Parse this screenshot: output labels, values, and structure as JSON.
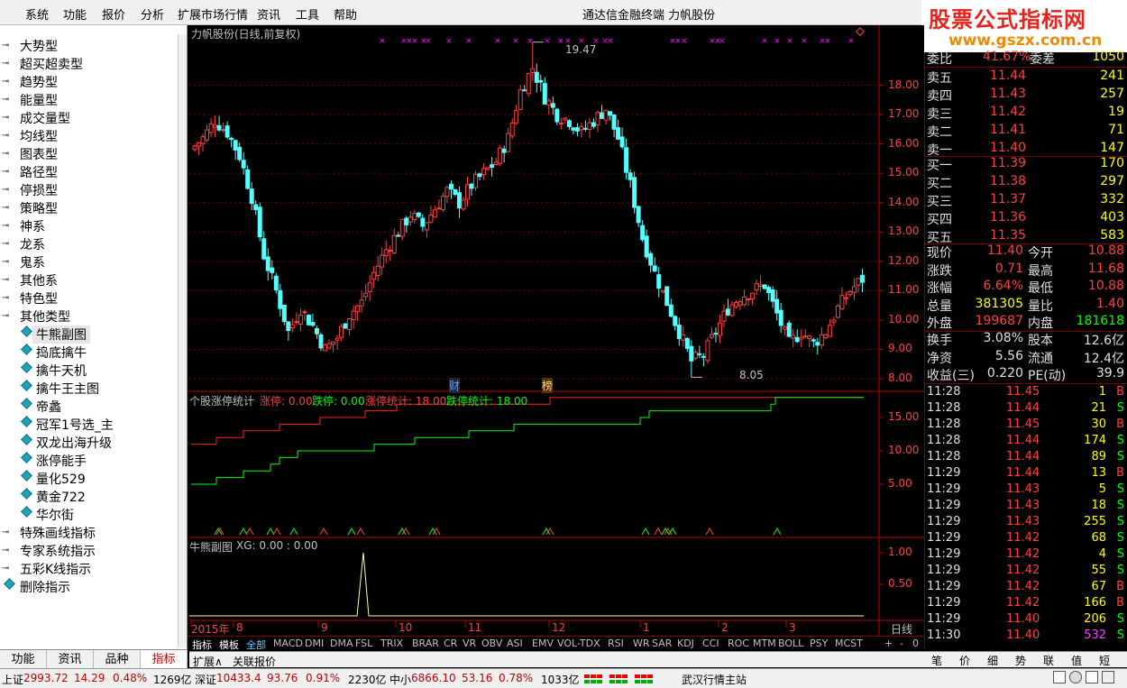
{
  "menu": [
    "系统",
    "功能",
    "报价",
    "分析",
    "扩展市场行情",
    "资讯",
    "工具",
    "帮助"
  ],
  "app_title": "通达信金融终端   力帆股份",
  "watermark": {
    "title": "股票公式指标网",
    "url": "www.gszx.com.cn"
  },
  "tree": [
    {
      "label": "大势型",
      "level": 0
    },
    {
      "label": "超买超卖型",
      "level": 0
    },
    {
      "label": "趋势型",
      "level": 0
    },
    {
      "label": "能量型",
      "level": 0
    },
    {
      "label": "成交量型",
      "level": 0
    },
    {
      "label": "均线型",
      "level": 0
    },
    {
      "label": "图表型",
      "level": 0
    },
    {
      "label": "路径型",
      "level": 0
    },
    {
      "label": "停损型",
      "level": 0
    },
    {
      "label": "策略型",
      "level": 0
    },
    {
      "label": "神系",
      "level": 0
    },
    {
      "label": "龙系",
      "level": 0
    },
    {
      "label": "鬼系",
      "level": 0
    },
    {
      "label": "其他系",
      "level": 0
    },
    {
      "label": "特色型",
      "level": 0
    },
    {
      "label": "其他类型",
      "level": 0
    },
    {
      "label": "牛熊副图",
      "level": 1,
      "selected": true
    },
    {
      "label": "捣底擒牛",
      "level": 1
    },
    {
      "label": "擒牛天机",
      "level": 1
    },
    {
      "label": "擒牛王主图",
      "level": 1
    },
    {
      "label": "帝蠡",
      "level": 1
    },
    {
      "label": "冠军1号选_主",
      "level": 1
    },
    {
      "label": "双龙出海升级",
      "level": 1
    },
    {
      "label": "涨停能手",
      "level": 1
    },
    {
      "label": "量化529",
      "level": 1
    },
    {
      "label": "黄金722",
      "level": 1
    },
    {
      "label": "华尔街",
      "level": 1
    },
    {
      "label": "特殊画线指标",
      "level": 0
    },
    {
      "label": "专家系统指示",
      "level": 0
    },
    {
      "label": "五彩K线指示",
      "level": 0
    },
    {
      "label": "删除指示",
      "level": 2
    }
  ],
  "sidebar_tabs": [
    "功能",
    "资讯",
    "品种",
    "指标"
  ],
  "chart": {
    "title": "力帆股份(日线,前复权)",
    "high_label": "19.47",
    "low_label": "8.05",
    "price_axis": [
      "18.00",
      "17.00",
      "16.00",
      "15.00",
      "14.00",
      "13.00",
      "12.00",
      "11.00",
      "10.00",
      "9.00",
      "8.00"
    ],
    "marker_cai": "财",
    "marker_bang": "榜",
    "sub1": {
      "name": "个股涨停统计",
      "zt": "涨停: 0.00",
      "dt": "跌停: 0.00",
      "ztc": "涨停统计: 18.00",
      "dtc": "跌停统计: 18.00",
      "axis": [
        "15.00",
        "10.00",
        "5.00"
      ]
    },
    "sub2": {
      "name": "牛熊副图",
      "xg": "XG: 0.00 : 0.00",
      "axis": [
        "1.00",
        "0.50"
      ]
    },
    "date_axis": [
      "2015年",
      "8",
      "9",
      "10",
      "11",
      "12",
      "1",
      "2",
      "3"
    ],
    "period": "日线",
    "window_btns": [
      "+",
      "-",
      "0"
    ]
  },
  "chart_data": {
    "type": "candlestick",
    "title": "力帆股份(日线,前复权)",
    "ylim": [
      7.6,
      19.8
    ],
    "high": 19.47,
    "low": 8.05,
    "closes_approx": [
      15.8,
      16.2,
      16.8,
      16.4,
      15.6,
      14.2,
      12.2,
      11.0,
      9.6,
      10.4,
      9.8,
      9.0,
      9.4,
      10.2,
      10.6,
      11.6,
      12.4,
      13.0,
      13.6,
      13.2,
      13.8,
      14.4,
      14.0,
      14.6,
      15.0,
      15.4,
      16.2,
      17.8,
      18.6,
      17.6,
      17.0,
      16.8,
      16.4,
      16.8,
      17.2,
      16.2,
      14.6,
      12.8,
      11.6,
      10.6,
      9.6,
      8.6,
      8.8,
      9.6,
      10.4,
      10.8,
      11.0,
      11.2,
      10.2,
      9.2,
      9.6,
      9.2,
      9.6,
      10.4,
      11.0,
      11.4
    ]
  },
  "indicator_tabs": [
    "指标",
    "模板",
    "全部",
    "MACD",
    "DMI",
    "DMA",
    "FSL",
    "TRIX",
    "BRAR",
    "CR",
    "VR",
    "OBV",
    "ASI",
    "EMV",
    "VOL-TDX",
    "RSI",
    "WR",
    "SAR",
    "KDJ",
    "CCI",
    "ROC",
    "MTM",
    "BOLL",
    "PSY",
    "MCST"
  ],
  "ext_tabs": [
    "扩展∧",
    "关联报价"
  ],
  "quote": {
    "weibi": {
      "label": "委比",
      "value": "41.67%",
      "label2": "委差",
      "value2": "1050"
    },
    "sell": [
      {
        "label": "卖五",
        "price": "11.44",
        "vol": "241"
      },
      {
        "label": "卖四",
        "price": "11.43",
        "vol": "257"
      },
      {
        "label": "卖三",
        "price": "11.42",
        "vol": "19"
      },
      {
        "label": "卖二",
        "price": "11.41",
        "vol": "71"
      },
      {
        "label": "卖一",
        "price": "11.40",
        "vol": "147"
      }
    ],
    "buy": [
      {
        "label": "买一",
        "price": "11.39",
        "vol": "170"
      },
      {
        "label": "买二",
        "price": "11.38",
        "vol": "297"
      },
      {
        "label": "买三",
        "price": "11.37",
        "vol": "332"
      },
      {
        "label": "买四",
        "price": "11.36",
        "vol": "403"
      },
      {
        "label": "买五",
        "price": "11.35",
        "vol": "583"
      }
    ],
    "stats1": [
      {
        "l1": "现价",
        "v1": "11.40",
        "l2": "今开",
        "v2": "10.88"
      },
      {
        "l1": "涨跌",
        "v1": "0.71",
        "l2": "最高",
        "v2": "11.68"
      },
      {
        "l1": "涨幅",
        "v1": "6.64%",
        "l2": "最低",
        "v2": "10.88"
      },
      {
        "l1": "总量",
        "v1": "381305",
        "l2": "量比",
        "v2": "1.40"
      },
      {
        "l1": "外盘",
        "v1": "199687",
        "l2": "内盘",
        "v2": "181618"
      }
    ],
    "stats2": [
      {
        "l1": "换手",
        "v1": "3.08%",
        "l2": "股本",
        "v2": "12.6亿"
      },
      {
        "l1": "净资",
        "v1": "5.56",
        "l2": "流通",
        "v2": "12.4亿"
      },
      {
        "l1": "收益(三)",
        "v1": "0.220",
        "l2": "PE(动)",
        "v2": "39.9"
      }
    ],
    "ticks": [
      {
        "t": "11:28",
        "p": "11.45",
        "v": "1",
        "s": "B"
      },
      {
        "t": "11:28",
        "p": "11.44",
        "v": "21",
        "s": "S"
      },
      {
        "t": "11:28",
        "p": "11.45",
        "v": "30",
        "s": "B"
      },
      {
        "t": "11:28",
        "p": "11.44",
        "v": "174",
        "s": "S"
      },
      {
        "t": "11:28",
        "p": "11.44",
        "v": "89",
        "s": "S"
      },
      {
        "t": "11:29",
        "p": "11.44",
        "v": "13",
        "s": "B"
      },
      {
        "t": "11:29",
        "p": "11.43",
        "v": "5",
        "s": "S"
      },
      {
        "t": "11:29",
        "p": "11.43",
        "v": "18",
        "s": "S"
      },
      {
        "t": "11:29",
        "p": "11.43",
        "v": "255",
        "s": "S"
      },
      {
        "t": "11:29",
        "p": "11.42",
        "v": "68",
        "s": "S"
      },
      {
        "t": "11:29",
        "p": "11.42",
        "v": "4",
        "s": "S"
      },
      {
        "t": "11:29",
        "p": "11.42",
        "v": "55",
        "s": "S"
      },
      {
        "t": "11:29",
        "p": "11.42",
        "v": "67",
        "s": "B"
      },
      {
        "t": "11:29",
        "p": "11.42",
        "v": "166",
        "s": "B"
      },
      {
        "t": "11:29",
        "p": "11.40",
        "v": "206",
        "s": "S"
      },
      {
        "t": "11:30",
        "p": "11.40",
        "v": "532",
        "s": "S"
      }
    ]
  },
  "right_tabs": [
    "笔",
    "价",
    "细",
    "势",
    "联",
    "值",
    "短"
  ],
  "status": {
    "sh_label": "上证",
    "sh_val": "2993.72",
    "sh_chg": "14.29",
    "sh_pct": "0.48%",
    "sh_amt": "1269亿",
    "sz_label": "深证",
    "sz_val": "10433.4",
    "sz_chg": "93.76",
    "sz_pct": "0.91%",
    "sz_amt": "2230亿",
    "zx_label": "中小",
    "zx_val": "6866.10",
    "zx_chg": "53.16",
    "zx_pct": "0.78%",
    "zx_amt": "1033亿",
    "server": "武汉行情主站"
  },
  "colors": {
    "up": "#ff4040",
    "down": "#54ffff",
    "axis": "#c00000",
    "yellow": "#ffff00",
    "green": "#00ff00",
    "purple": "#ff00ff"
  }
}
